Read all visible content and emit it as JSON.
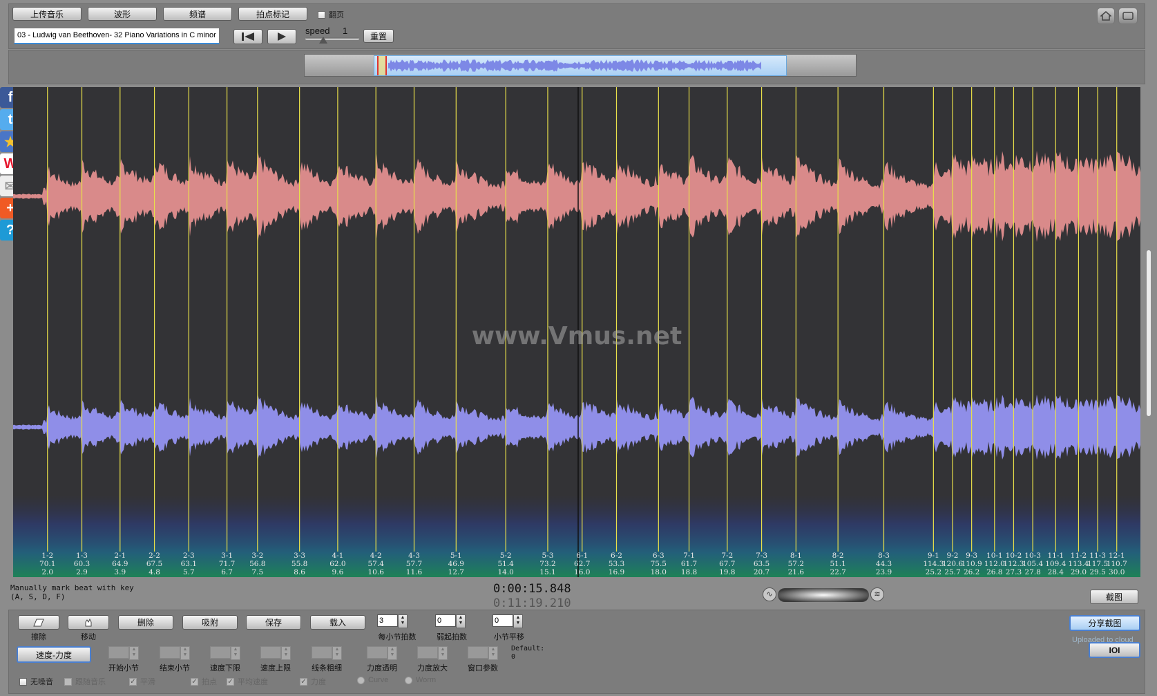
{
  "toolbar": {
    "upload": "上传音乐",
    "waveform": "波形",
    "spectrum": "频谱",
    "beat_mark": "拍点标记",
    "page_flip": "翻页",
    "filename": "03 - Ludwig van Beethoven- 32 Piano Variations in C minor",
    "speed_label": "speed",
    "speed_value": "1",
    "reset": "重置"
  },
  "watermark": "www.Vmus.net",
  "beats": [
    {
      "label": "1-2",
      "tempo": "70.1",
      "time": "2.0"
    },
    {
      "label": "1-3",
      "tempo": "60.3",
      "time": "2.9"
    },
    {
      "label": "2-1",
      "tempo": "64.9",
      "time": "3.9"
    },
    {
      "label": "2-2",
      "tempo": "67.5",
      "time": "4.8"
    },
    {
      "label": "2-3",
      "tempo": "63.1",
      "time": "5.7"
    },
    {
      "label": "3-1",
      "tempo": "71.7",
      "time": "6.7"
    },
    {
      "label": "3-2",
      "tempo": "56.8",
      "time": "7.5"
    },
    {
      "label": "3-3",
      "tempo": "55.8",
      "time": "8.6"
    },
    {
      "label": "4-1",
      "tempo": "62.0",
      "time": "9.6"
    },
    {
      "label": "4-2",
      "tempo": "57.4",
      "time": "10.6"
    },
    {
      "label": "4-3",
      "tempo": "57.7",
      "time": "11.6"
    },
    {
      "label": "5-1",
      "tempo": "46.9",
      "time": "12.7"
    },
    {
      "label": "5-2",
      "tempo": "51.4",
      "time": "14.0"
    },
    {
      "label": "5-3",
      "tempo": "73.2",
      "time": "15.1"
    },
    {
      "label": "6-1",
      "tempo": "62.7",
      "time": "16.0"
    },
    {
      "label": "6-2",
      "tempo": "53.3",
      "time": "16.9"
    },
    {
      "label": "6-3",
      "tempo": "75.5",
      "time": "18.0"
    },
    {
      "label": "7-1",
      "tempo": "61.7",
      "time": "18.8"
    },
    {
      "label": "7-2",
      "tempo": "67.7",
      "time": "19.8"
    },
    {
      "label": "7-3",
      "tempo": "63.5",
      "time": "20.7"
    },
    {
      "label": "8-1",
      "tempo": "57.2",
      "time": "21.6"
    },
    {
      "label": "8-2",
      "tempo": "51.1",
      "time": "22.7"
    },
    {
      "label": "8-3",
      "tempo": "44.3",
      "time": "23.9"
    },
    {
      "label": "9-1",
      "tempo": "114.3",
      "time": "25.2"
    },
    {
      "label": "9-2",
      "tempo": "120.6",
      "time": "25.7"
    },
    {
      "label": "9-3",
      "tempo": "110.9",
      "time": "26.2"
    },
    {
      "label": "10-1",
      "tempo": "112.0",
      "time": "26.8"
    },
    {
      "label": "10-2",
      "tempo": "112.3",
      "time": "27.3"
    },
    {
      "label": "10-3",
      "tempo": "105.4",
      "time": "27.8"
    },
    {
      "label": "11-1",
      "tempo": "109.4",
      "time": "28.4"
    },
    {
      "label": "11-2",
      "tempo": "113.4",
      "time": "29.0"
    },
    {
      "label": "11-3",
      "tempo": "117.5",
      "time": "29.5"
    },
    {
      "label": "12-1",
      "tempo": "110.7",
      "time": "30.0"
    }
  ],
  "hint": {
    "line1": "Manually mark beat with key",
    "line2": "(A, S, D, F)"
  },
  "time": {
    "current": "0:00:15.848",
    "total": "0:11:19.210"
  },
  "screenshot_btn": "截图",
  "bottom": {
    "erase": "擦除",
    "move": "移动",
    "delete": "删除",
    "snap": "吸附",
    "save": "保存",
    "load": "载入",
    "beats_per_bar_value": "3",
    "beats_per_bar_label": "每小节拍数",
    "pickup_value": "0",
    "pickup_label": "弱起拍数",
    "bar_shift_value": "0",
    "bar_shift_label": "小节平移",
    "tempo_dynamics": "速度-力度",
    "start_bar": "开始小节",
    "end_bar": "结束小节",
    "speed_min": "速度下限",
    "speed_max": "速度上限",
    "line_width": "线条粗细",
    "dyn_opacity": "力度透明",
    "dyn_zoom": "力度放大",
    "window_param": "窗口参数",
    "default_label": "Default:",
    "default_value": "0",
    "no_noise": "无噪音",
    "follow_music": "跟随音乐",
    "smooth": "平滑",
    "beat_point": "拍点",
    "avg_speed": "平均速度",
    "dynamics": "力度",
    "curve": "Curve",
    "worm": "Worm",
    "share": "分享截图",
    "uploaded": "Uploaded to cloud",
    "ioi": "IOI"
  },
  "icons": {
    "home": "home-icon",
    "fullscreen": "fullscreen-icon",
    "prev": "skip-back-icon",
    "play": "play-icon"
  },
  "colors": {
    "waveform_top": "#d98a8a",
    "waveform_bottom": "#8f8ee8",
    "beat_line": "#e9e04a",
    "background": "#333336"
  }
}
